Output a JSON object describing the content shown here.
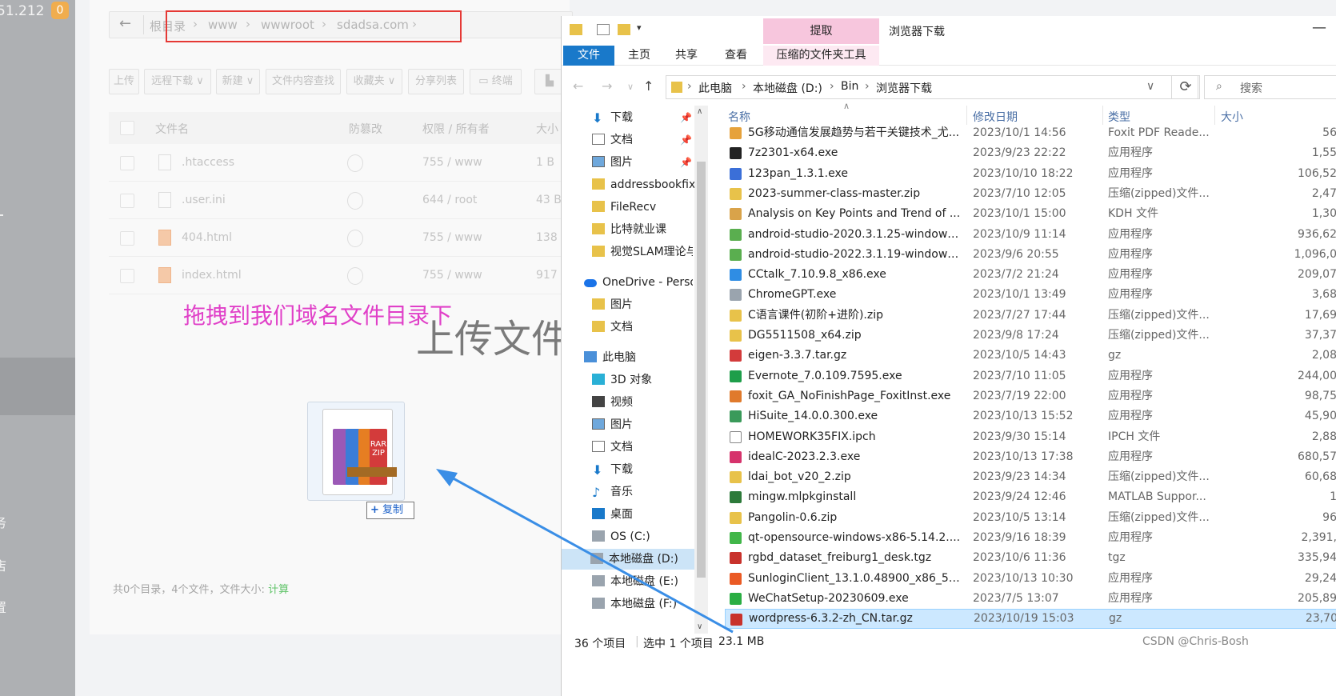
{
  "sidebar": {
    "ip_fragment": "51.212",
    "badge": "0",
    "menu_fragments": [
      "务",
      "店",
      "置"
    ]
  },
  "breadcrumb": {
    "items": [
      "根目录",
      "www",
      "wwwroot",
      "sdadsa.com"
    ]
  },
  "toolbar": {
    "buttons": [
      "上传",
      "远程下载",
      "新建",
      "文件内容查找",
      "收藏夹",
      "分享列表",
      "终端"
    ]
  },
  "table": {
    "headers": [
      "文件名",
      "防篡改",
      "权限 / 所有者",
      "大小"
    ],
    "rows": [
      {
        "name": ".htaccess",
        "perm": "755 / www",
        "size": "1 B"
      },
      {
        "name": ".user.ini",
        "perm": "644 / root",
        "size": "43 B"
      },
      {
        "name": "404.html",
        "perm": "755 / www",
        "size": "138"
      },
      {
        "name": "index.html",
        "perm": "755 / www",
        "size": "917"
      }
    ]
  },
  "annotation": "拖拽到我们域名文件目录下",
  "upload_text": "上传文件",
  "drag": {
    "copy_label": "复制",
    "rar_label": "RAR",
    "zip_label": "ZIP"
  },
  "footer": {
    "summary": "共0个目录，4个文件，文件大小:",
    "calc": "计算"
  },
  "explorer": {
    "ribbon": {
      "extract": "提取",
      "window_title": "浏览器下载",
      "tabs": [
        "文件",
        "主页",
        "共享",
        "查看"
      ],
      "zip_tools": "压缩的文件夹工具"
    },
    "address": [
      "此电脑",
      "本地磁盘 (D:)",
      "Bin",
      "浏览器下载"
    ],
    "search_placeholder": "搜索",
    "nav_tree": [
      "下载",
      "文档",
      "图片",
      "addressbookfix",
      "FileRecv",
      "比特就业课",
      "视觉SLAM理论与",
      "OneDrive - Personal",
      "图片",
      "文档",
      "此电脑",
      "3D 对象",
      "视频",
      "图片",
      "文档",
      "下载",
      "音乐",
      "桌面",
      "OS (C:)",
      "本地磁盘 (D:)",
      "本地磁盘 (E:)",
      "本地磁盘 (F:)"
    ],
    "columns": [
      "名称",
      "修改日期",
      "类型",
      "大小"
    ],
    "files": [
      {
        "name": "5G移动通信发展趋势与若干关键技术_尤...",
        "date": "2023/10/1 14:56",
        "type": "Foxit PDF Reade...",
        "size": "56"
      },
      {
        "name": "7z2301-x64.exe",
        "date": "2023/9/23 22:22",
        "type": "应用程序",
        "size": "1,55"
      },
      {
        "name": "123pan_1.3.1.exe",
        "date": "2023/10/10 18:22",
        "type": "应用程序",
        "size": "106,52"
      },
      {
        "name": "2023-summer-class-master.zip",
        "date": "2023/7/10 12:05",
        "type": "压缩(zipped)文件...",
        "size": "2,47"
      },
      {
        "name": "Analysis on Key Points and Trend of ...",
        "date": "2023/10/1 15:00",
        "type": "KDH 文件",
        "size": "1,30"
      },
      {
        "name": "android-studio-2020.3.1.25-windows....",
        "date": "2023/10/9 11:14",
        "type": "应用程序",
        "size": "936,62"
      },
      {
        "name": "android-studio-2022.3.1.19-windows....",
        "date": "2023/9/6 20:55",
        "type": "应用程序",
        "size": "1,096,0"
      },
      {
        "name": "CCtalk_7.10.9.8_x86.exe",
        "date": "2023/7/2 21:24",
        "type": "应用程序",
        "size": "209,07"
      },
      {
        "name": "ChromeGPT.exe",
        "date": "2023/10/1 13:49",
        "type": "应用程序",
        "size": "3,68"
      },
      {
        "name": "C语言课件(初阶+进阶).zip",
        "date": "2023/7/27 17:44",
        "type": "压缩(zipped)文件...",
        "size": "17,69"
      },
      {
        "name": "DG5511508_x64.zip",
        "date": "2023/9/8 17:24",
        "type": "压缩(zipped)文件...",
        "size": "37,37"
      },
      {
        "name": "eigen-3.3.7.tar.gz",
        "date": "2023/10/5 14:43",
        "type": "gz",
        "size": "2,08"
      },
      {
        "name": "Evernote_7.0.109.7595.exe",
        "date": "2023/7/10 11:05",
        "type": "应用程序",
        "size": "244,00"
      },
      {
        "name": "foxit_GA_NoFinishPage_FoxitInst.exe",
        "date": "2023/7/19 22:00",
        "type": "应用程序",
        "size": "98,75"
      },
      {
        "name": "HiSuite_14.0.0.300.exe",
        "date": "2023/10/13 15:52",
        "type": "应用程序",
        "size": "45,90"
      },
      {
        "name": "HOMEWORK35FIX.ipch",
        "date": "2023/9/30 15:14",
        "type": "IPCH 文件",
        "size": "2,88"
      },
      {
        "name": "idealC-2023.2.3.exe",
        "date": "2023/10/13 17:38",
        "type": "应用程序",
        "size": "680,57"
      },
      {
        "name": "ldai_bot_v20_2.zip",
        "date": "2023/9/23 14:34",
        "type": "压缩(zipped)文件...",
        "size": "60,68"
      },
      {
        "name": "mingw.mlpkginstall",
        "date": "2023/9/24 12:46",
        "type": "MATLAB Suppor...",
        "size": "1"
      },
      {
        "name": "Pangolin-0.6.zip",
        "date": "2023/10/5 13:14",
        "type": "压缩(zipped)文件...",
        "size": "96"
      },
      {
        "name": "qt-opensource-windows-x86-5.14.2....",
        "date": "2023/9/16 18:39",
        "type": "应用程序",
        "size": "2,391,"
      },
      {
        "name": "rgbd_dataset_freiburg1_desk.tgz",
        "date": "2023/10/6 11:36",
        "type": "tgz",
        "size": "335,94"
      },
      {
        "name": "SunloginClient_13.1.0.48900_x86_51...",
        "date": "2023/10/13 10:30",
        "type": "应用程序",
        "size": "29,24"
      },
      {
        "name": "WeChatSetup-20230609.exe",
        "date": "2023/7/5 13:07",
        "type": "应用程序",
        "size": "205,89"
      },
      {
        "name": "wordpress-6.3.2-zh_CN.tar.gz",
        "date": "2023/10/19 15:03",
        "type": "gz",
        "size": "23,70"
      }
    ],
    "status": {
      "count": "36 个项目",
      "selected": "选中 1 个项目",
      "size": "23.1 MB"
    }
  },
  "watermark": "CSDN @Chris-Bosh",
  "colors": {
    "accent": "#1979ca",
    "annotation": "#e040c8",
    "redbox": "#e53935",
    "arrow": "#3a8ee6"
  }
}
